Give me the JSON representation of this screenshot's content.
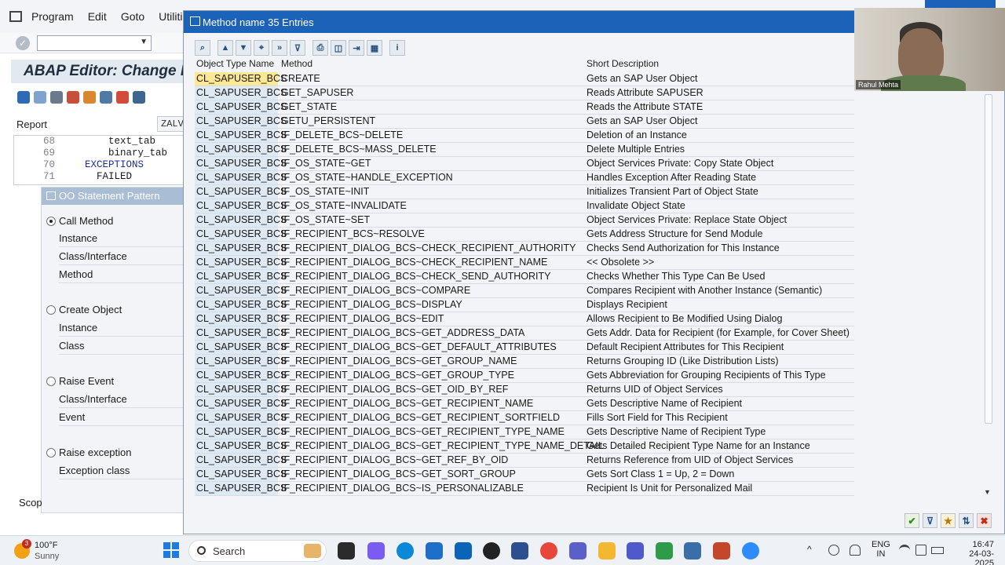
{
  "menu": {
    "items": [
      "Program",
      "Edit",
      "Goto",
      "Utilities"
    ]
  },
  "editor": {
    "title": "ABAP Editor: Change I",
    "report_label": "Report",
    "report_value": "ZALV",
    "code_lines": [
      {
        "num": "68",
        "text": "        text_tab"
      },
      {
        "num": "69",
        "text": "        binary_tab"
      },
      {
        "num": "70",
        "text": "    EXCEPTIONS"
      },
      {
        "num": "71",
        "text": "      FAILED"
      }
    ]
  },
  "oo_pattern": {
    "title": "OO Statement Pattern",
    "call_method": "Call Method",
    "call_instance": "Instance",
    "call_class": "Class/Interface",
    "call_method_field": "Method",
    "create_object": "Create Object",
    "create_instance": "Instance",
    "create_class": "Class",
    "raise_event": "Raise Event",
    "event_class": "Class/Interface",
    "event_field": "Event",
    "raise_exception": "Raise exception",
    "exception_class": "Exception class",
    "scope_label": "Scop"
  },
  "popup": {
    "title": "Method name 35 Entries",
    "headers": {
      "type": "Object Type Name",
      "method": "Method",
      "desc": "Short Description"
    },
    "rows": [
      {
        "type": "CL_SAPUSER_BCS",
        "method": "CREATE",
        "desc": "Gets an SAP User Object"
      },
      {
        "type": "CL_SAPUSER_BCS",
        "method": "GET_SAPUSER",
        "desc": "Reads Attribute SAPUSER"
      },
      {
        "type": "CL_SAPUSER_BCS",
        "method": "GET_STATE",
        "desc": "Reads the Attribute STATE"
      },
      {
        "type": "CL_SAPUSER_BCS",
        "method": "GETU_PERSISTENT",
        "desc": "Gets an SAP User Object"
      },
      {
        "type": "CL_SAPUSER_BCS",
        "method": "IF_DELETE_BCS~DELETE",
        "desc": "Deletion of an Instance"
      },
      {
        "type": "CL_SAPUSER_BCS",
        "method": "IF_DELETE_BCS~MASS_DELETE",
        "desc": "Delete Multiple Entries"
      },
      {
        "type": "CL_SAPUSER_BCS",
        "method": "IF_OS_STATE~GET",
        "desc": "Object Services Private: Copy State Object"
      },
      {
        "type": "CL_SAPUSER_BCS",
        "method": "IF_OS_STATE~HANDLE_EXCEPTION",
        "desc": "Handles Exception After Reading State"
      },
      {
        "type": "CL_SAPUSER_BCS",
        "method": "IF_OS_STATE~INIT",
        "desc": "Initializes Transient Part of Object State"
      },
      {
        "type": "CL_SAPUSER_BCS",
        "method": "IF_OS_STATE~INVALIDATE",
        "desc": "Invalidate Object State"
      },
      {
        "type": "CL_SAPUSER_BCS",
        "method": "IF_OS_STATE~SET",
        "desc": "Object Services Private: Replace State Object"
      },
      {
        "type": "CL_SAPUSER_BCS",
        "method": "IF_RECIPIENT_BCS~RESOLVE",
        "desc": "Gets Address Structure for Send Module"
      },
      {
        "type": "CL_SAPUSER_BCS",
        "method": "IF_RECIPIENT_DIALOG_BCS~CHECK_RECIPIENT_AUTHORITY",
        "desc": "Checks Send Authorization for This Instance"
      },
      {
        "type": "CL_SAPUSER_BCS",
        "method": "IF_RECIPIENT_DIALOG_BCS~CHECK_RECIPIENT_NAME",
        "desc": "<< Obsolete >>"
      },
      {
        "type": "CL_SAPUSER_BCS",
        "method": "IF_RECIPIENT_DIALOG_BCS~CHECK_SEND_AUTHORITY",
        "desc": "Checks Whether This Type Can Be Used"
      },
      {
        "type": "CL_SAPUSER_BCS",
        "method": "IF_RECIPIENT_DIALOG_BCS~COMPARE",
        "desc": "Compares Recipient with Another Instance (Semantic)"
      },
      {
        "type": "CL_SAPUSER_BCS",
        "method": "IF_RECIPIENT_DIALOG_BCS~DISPLAY",
        "desc": "Displays Recipient"
      },
      {
        "type": "CL_SAPUSER_BCS",
        "method": "IF_RECIPIENT_DIALOG_BCS~EDIT",
        "desc": "Allows Recipient to Be Modified Using Dialog"
      },
      {
        "type": "CL_SAPUSER_BCS",
        "method": "IF_RECIPIENT_DIALOG_BCS~GET_ADDRESS_DATA",
        "desc": "Gets Addr. Data for Recipient (for Example, for Cover Sheet)"
      },
      {
        "type": "CL_SAPUSER_BCS",
        "method": "IF_RECIPIENT_DIALOG_BCS~GET_DEFAULT_ATTRIBUTES",
        "desc": "Default Recipient Attributes for This Recipient"
      },
      {
        "type": "CL_SAPUSER_BCS",
        "method": "IF_RECIPIENT_DIALOG_BCS~GET_GROUP_NAME",
        "desc": "Returns Grouping ID (Like Distribution Lists)"
      },
      {
        "type": "CL_SAPUSER_BCS",
        "method": "IF_RECIPIENT_DIALOG_BCS~GET_GROUP_TYPE",
        "desc": "Gets Abbreviation for Grouping Recipients of This Type"
      },
      {
        "type": "CL_SAPUSER_BCS",
        "method": "IF_RECIPIENT_DIALOG_BCS~GET_OID_BY_REF",
        "desc": "Returns UID of Object Services"
      },
      {
        "type": "CL_SAPUSER_BCS",
        "method": "IF_RECIPIENT_DIALOG_BCS~GET_RECIPIENT_NAME",
        "desc": "Gets Descriptive Name of Recipient"
      },
      {
        "type": "CL_SAPUSER_BCS",
        "method": "IF_RECIPIENT_DIALOG_BCS~GET_RECIPIENT_SORTFIELD",
        "desc": "Fills Sort Field for This Recipient"
      },
      {
        "type": "CL_SAPUSER_BCS",
        "method": "IF_RECIPIENT_DIALOG_BCS~GET_RECIPIENT_TYPE_NAME",
        "desc": "Gets Descriptive Name of Recipient Type"
      },
      {
        "type": "CL_SAPUSER_BCS",
        "method": "IF_RECIPIENT_DIALOG_BCS~GET_RECIPIENT_TYPE_NAME_DETAIL",
        "desc": "Gets Detailed Recipient Type Name for an Instance"
      },
      {
        "type": "CL_SAPUSER_BCS",
        "method": "IF_RECIPIENT_DIALOG_BCS~GET_REF_BY_OID",
        "desc": "Returns Reference from UID of Object Services"
      },
      {
        "type": "CL_SAPUSER_BCS",
        "method": "IF_RECIPIENT_DIALOG_BCS~GET_SORT_GROUP",
        "desc": "Gets Sort Class 1 = Up, 2 = Down"
      },
      {
        "type": "CL_SAPUSER_BCS",
        "method": "IF_RECIPIENT_DIALOG_BCS~IS_PERSONALIZABLE",
        "desc": "Recipient Is Unit for Personalized Mail"
      }
    ]
  },
  "webcam": {
    "name": "Rahul Mehta"
  },
  "taskbar": {
    "weather_badge": "3",
    "temperature": "100°F",
    "condition": "Sunny",
    "search_label": "Search",
    "lang_top": "ENG",
    "lang_bottom": "IN",
    "time": "16:47",
    "date": "24-03-2025"
  },
  "colors": {
    "title_blue": "#1c62b9",
    "selected_yellow": "#ffe893",
    "key_column": "#dfe9f3"
  }
}
